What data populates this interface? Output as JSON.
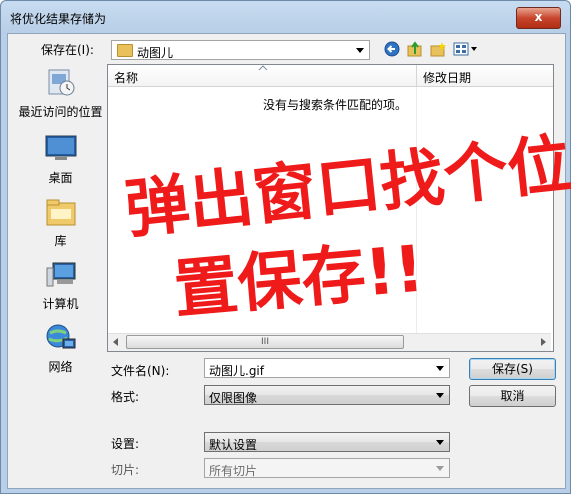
{
  "window": {
    "title": "将优化结果存储为",
    "close_glyph": "x"
  },
  "toolbar": {
    "save_in_label": "保存在(I):",
    "save_in_value": "动图儿",
    "icons": [
      "back-icon",
      "up-folder-icon",
      "new-folder-icon",
      "view-menu-icon"
    ]
  },
  "places": [
    {
      "label": "最近访问的位置",
      "icon": "recent-places-icon"
    },
    {
      "label": "桌面",
      "icon": "desktop-icon"
    },
    {
      "label": "库",
      "icon": "libraries-icon"
    },
    {
      "label": "计算机",
      "icon": "computer-icon"
    },
    {
      "label": "网络",
      "icon": "network-icon"
    }
  ],
  "list": {
    "columns": [
      "名称",
      "修改日期"
    ],
    "empty_message": "没有与搜索条件匹配的项。",
    "scroll_grip": "III"
  },
  "form": {
    "filename_label": "文件名(N):",
    "filename_value": "动图儿.gif",
    "format_label": "格式:",
    "format_value": "仅限图像",
    "settings_label": "设置:",
    "settings_value": "默认设置",
    "slices_label": "切片:",
    "slices_value": "所有切片"
  },
  "buttons": {
    "save": "保存(S)",
    "cancel": "取消"
  },
  "annotation": {
    "line1": "弹出窗口找个位",
    "line2": "置保存!!",
    "color": "#ef1a1a"
  }
}
